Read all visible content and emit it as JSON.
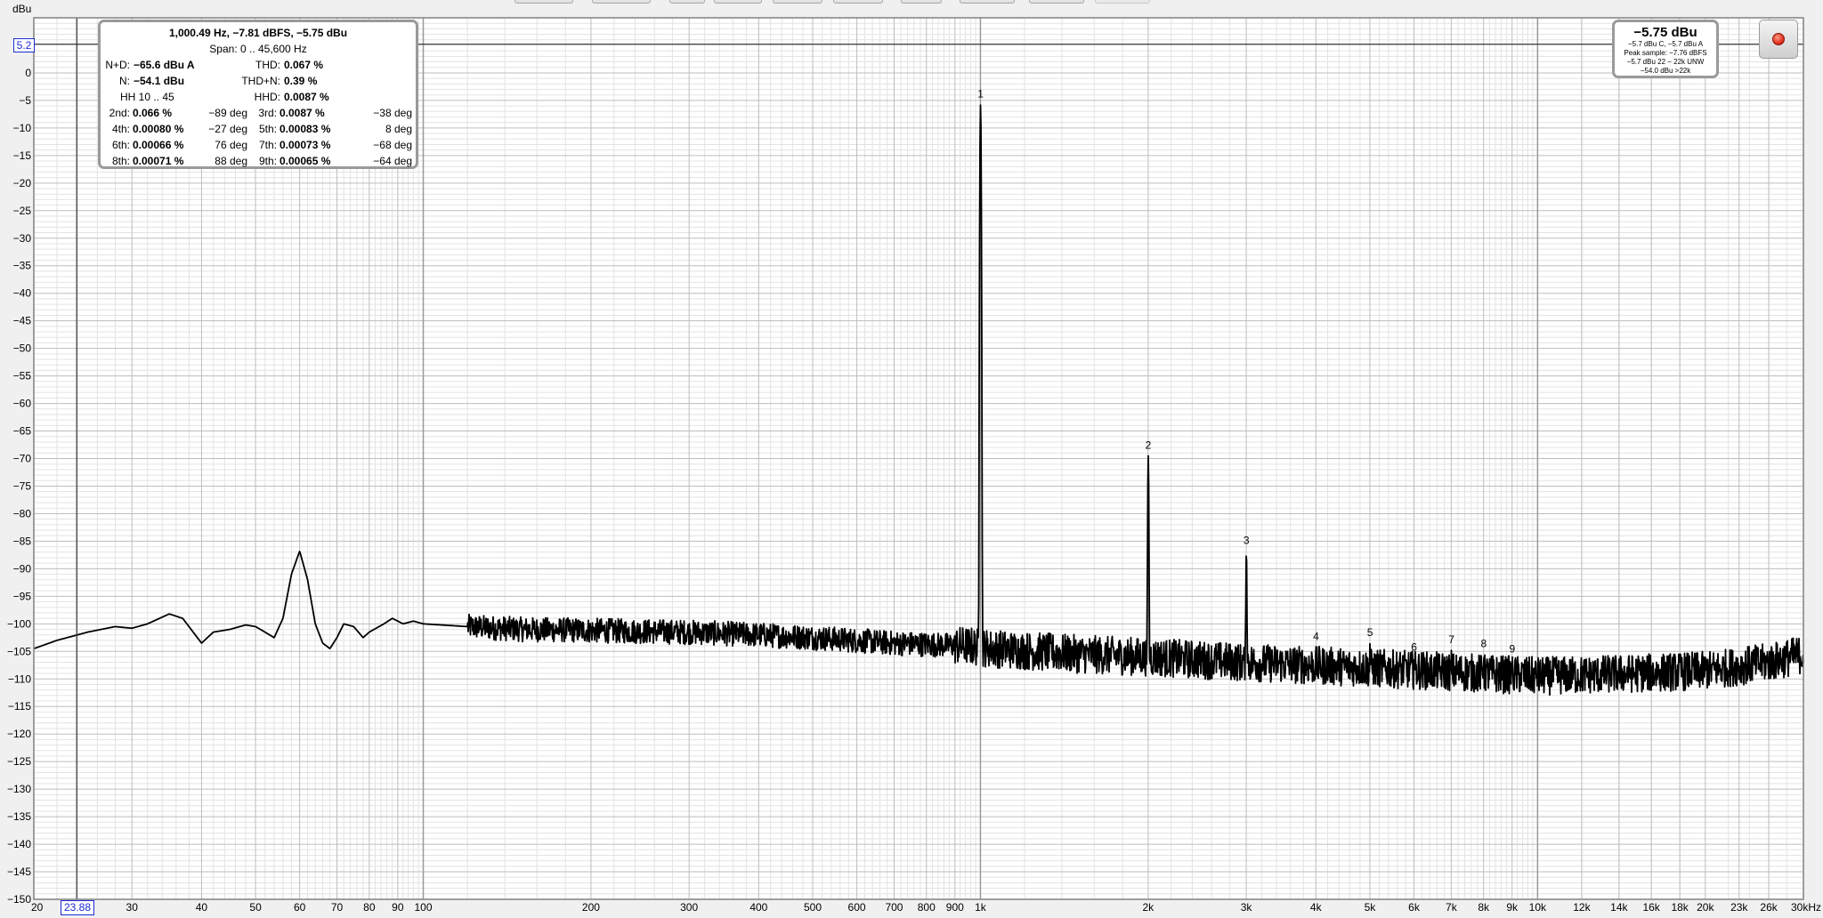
{
  "chart_data": {
    "type": "line",
    "ylabel": "dBu",
    "x_scale": "log",
    "xlim": [
      20,
      30000
    ],
    "ylim": [
      -150,
      10
    ],
    "x_ticks": [
      {
        "v": 20,
        "label": "20"
      },
      {
        "v": 30,
        "label": "30"
      },
      {
        "v": 40,
        "label": "40"
      },
      {
        "v": 50,
        "label": "50"
      },
      {
        "v": 60,
        "label": "60"
      },
      {
        "v": 70,
        "label": "70"
      },
      {
        "v": 80,
        "label": "80"
      },
      {
        "v": 90,
        "label": "90"
      },
      {
        "v": 100,
        "label": "100"
      },
      {
        "v": 200,
        "label": "200"
      },
      {
        "v": 300,
        "label": "300"
      },
      {
        "v": 400,
        "label": "400"
      },
      {
        "v": 500,
        "label": "500"
      },
      {
        "v": 600,
        "label": "600"
      },
      {
        "v": 700,
        "label": "700"
      },
      {
        "v": 800,
        "label": "800"
      },
      {
        "v": 900,
        "label": "900"
      },
      {
        "v": 1000,
        "label": "1k"
      },
      {
        "v": 2000,
        "label": "2k"
      },
      {
        "v": 3000,
        "label": "3k"
      },
      {
        "v": 4000,
        "label": "4k"
      },
      {
        "v": 5000,
        "label": "5k"
      },
      {
        "v": 6000,
        "label": "6k"
      },
      {
        "v": 7000,
        "label": "7k"
      },
      {
        "v": 8000,
        "label": "8k"
      },
      {
        "v": 9000,
        "label": "9k"
      },
      {
        "v": 10000,
        "label": "10k"
      },
      {
        "v": 12000,
        "label": "12k"
      },
      {
        "v": 14000,
        "label": "14k"
      },
      {
        "v": 16000,
        "label": "16k"
      },
      {
        "v": 18000,
        "label": "18k"
      },
      {
        "v": 20000,
        "label": "20k"
      },
      {
        "v": 23000,
        "label": "23k"
      },
      {
        "v": 26000,
        "label": "26k"
      },
      {
        "v": 30000,
        "label": "30kHz"
      }
    ],
    "y_ticks": [
      0,
      -5,
      -10,
      -15,
      -20,
      -25,
      -30,
      -35,
      -40,
      -45,
      -50,
      -55,
      -60,
      -65,
      -70,
      -75,
      -80,
      -85,
      -90,
      -95,
      -100,
      -105,
      -110,
      -115,
      -120,
      -125,
      -130,
      -135,
      -140,
      -145,
      -150
    ],
    "cursor": {
      "x": 23.88,
      "x_label": "23.88",
      "y": 5.2,
      "y_label": "5.2"
    },
    "grid": true,
    "series": [
      {
        "color": "#000000",
        "baseline": [
          [
            20,
            -104.5
          ],
          [
            22,
            -103
          ],
          [
            25,
            -101.5
          ],
          [
            28,
            -100.5
          ],
          [
            30,
            -100.8
          ],
          [
            32,
            -100
          ],
          [
            35,
            -98.2
          ],
          [
            37,
            -99
          ],
          [
            40,
            -103.5
          ],
          [
            42,
            -101.5
          ],
          [
            45,
            -101
          ],
          [
            48,
            -100.2
          ],
          [
            50,
            -100.5
          ],
          [
            52,
            -101.5
          ],
          [
            54,
            -102.5
          ],
          [
            56,
            -99
          ],
          [
            58,
            -91
          ],
          [
            60,
            -86.8
          ],
          [
            62,
            -92
          ],
          [
            64,
            -100
          ],
          [
            66,
            -103.5
          ],
          [
            68,
            -104.5
          ],
          [
            70,
            -102.5
          ],
          [
            72,
            -100
          ],
          [
            75,
            -100.5
          ],
          [
            78,
            -102.5
          ],
          [
            80,
            -101.5
          ],
          [
            85,
            -100
          ],
          [
            88,
            -99
          ],
          [
            92,
            -100
          ],
          [
            96,
            -99.5
          ],
          [
            100,
            -100
          ],
          [
            120,
            -100.5
          ],
          [
            150,
            -101
          ],
          [
            200,
            -101.2
          ],
          [
            300,
            -101.5
          ],
          [
            400,
            -102
          ],
          [
            500,
            -102.5
          ],
          [
            700,
            -103.5
          ],
          [
            950,
            -104
          ],
          [
            1050,
            -104.5
          ],
          [
            1500,
            -105.5
          ],
          [
            2000,
            -106
          ],
          [
            3000,
            -107
          ],
          [
            5000,
            -108
          ],
          [
            8000,
            -109
          ],
          [
            10000,
            -109.5
          ],
          [
            15000,
            -109
          ],
          [
            20000,
            -108.5
          ],
          [
            26000,
            -107
          ],
          [
            30000,
            -105.5
          ]
        ],
        "noise_amplitude_db": 2.5,
        "peaks": [
          {
            "x": 1000.49,
            "y": -5.75,
            "marker": "1"
          },
          {
            "x": 2001,
            "y": -69.5,
            "marker": "2"
          },
          {
            "x": 3001.5,
            "y": -86.8,
            "marker": "3"
          },
          {
            "x": 4002,
            "y": -104.2,
            "marker": "4"
          },
          {
            "x": 5002.5,
            "y": -103.5,
            "marker": "5"
          },
          {
            "x": 6003,
            "y": -106.2,
            "marker": "6"
          },
          {
            "x": 7003.5,
            "y": -104.8,
            "marker": "7"
          },
          {
            "x": 8004,
            "y": -105.5,
            "marker": "8"
          },
          {
            "x": 9004.5,
            "y": -106.5,
            "marker": "9"
          }
        ]
      }
    ]
  },
  "distortion_panel": {
    "header": "1,000.49 Hz, −7.81 dBFS, −5.75 dBu",
    "span": "Span: 0 .. 45,600 Hz",
    "rows": [
      {
        "l1": "N+D:",
        "v1": "−65.6 dBu A",
        "l2": "THD:",
        "v2": "0.067 %"
      },
      {
        "l1": "N:",
        "v1": "−54.1 dBu",
        "l2": "THD+N:",
        "v2": "0.39 %"
      },
      {
        "l1": "HH 10 .. 45",
        "v1": "",
        "l2": "HHD:",
        "v2": "0.0087 %"
      }
    ],
    "harmonics": [
      {
        "l1": "2nd:",
        "v1": "0.066 %",
        "p1": "−89 deg",
        "l2": "3rd:",
        "v2": "0.0087 %",
        "p2": "−38 deg"
      },
      {
        "l1": "4th:",
        "v1": "0.00080 %",
        "p1": "−27 deg",
        "l2": "5th:",
        "v2": "0.00083 %",
        "p2": "8 deg"
      },
      {
        "l1": "6th:",
        "v1": "0.00066 %",
        "p1": "76 deg",
        "l2": "7th:",
        "v2": "0.00073 %",
        "p2": "−68 deg"
      },
      {
        "l1": "8th:",
        "v1": "0.00071 %",
        "p1": "88 deg",
        "l2": "9th:",
        "v2": "0.00065 %",
        "p2": "−64 deg"
      }
    ]
  },
  "level_panel": {
    "main": "−5.75 dBu",
    "lines": [
      "−5.7 dBu C, −5.7 dBu A",
      "Peak sample: −7.76 dBFS",
      "−5.7 dBu 22 − 22k UNW",
      "−54.0 dBu >22k"
    ]
  },
  "colors": {
    "background": "#f0f0f0",
    "plot_background": "#ffffff",
    "trace": "#000000",
    "grid_major": "#bdbdbd",
    "grid_minor": "#e3e3e3",
    "cursor_box": "#1a2bd6",
    "record": "#e0301c"
  },
  "icons": {
    "record": "record-icon"
  }
}
